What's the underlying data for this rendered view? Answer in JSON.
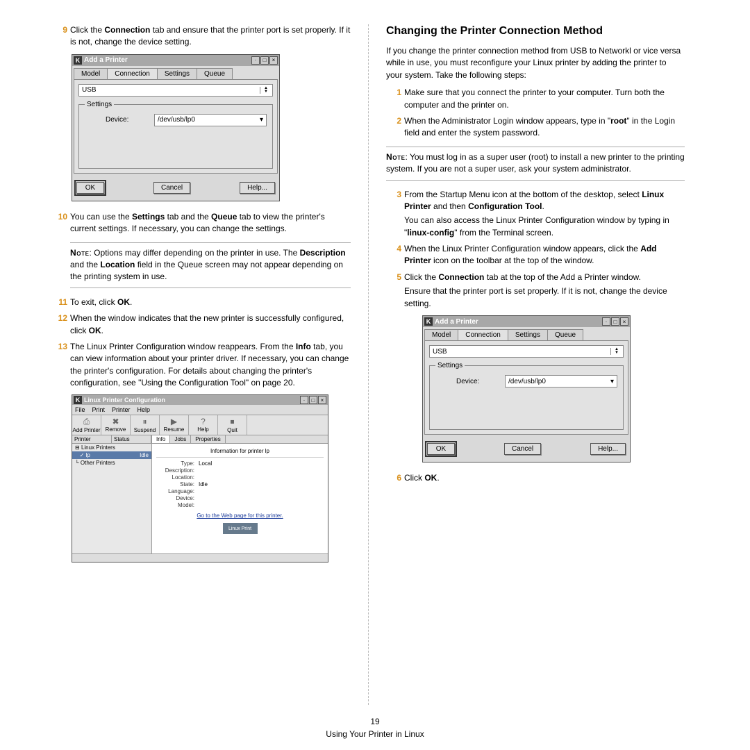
{
  "page": {
    "number": "19",
    "footer": "Using Your Printer in Linux"
  },
  "left": {
    "s9": {
      "num": "9",
      "t1": "Click the ",
      "t2": "Connection",
      "t3": " tab and ensure that the printer port is set properly. If it is not, change the device setting."
    },
    "s10": {
      "num": "10",
      "t1": "You can use the ",
      "t2": "Settings",
      "t3": " tab and the ",
      "t4": "Queue",
      "t5": " tab to view the printer's current settings. If necessary, you can change the settings."
    },
    "note": {
      "lbl": "Note",
      "t1": ": Options may differ depending on the printer in use. The ",
      "t2": "Description",
      "t3": " and the ",
      "t4": "Location",
      "t5": " field in the Queue screen may not appear depending on the printing system in use."
    },
    "s11": {
      "num": "11",
      "t1": "To exit, click ",
      "t2": "OK",
      "t3": "."
    },
    "s12": {
      "num": "12",
      "t1": "When the window indicates that the new printer is successfully configured, click ",
      "t2": "OK",
      "t3": "."
    },
    "s13": {
      "num": "13",
      "t1": "The Linux Printer Configuration window reappears. From the ",
      "t2": "Info",
      "t3": " tab, you can view information about your printer driver. If necessary, you can change the printer's configuration. For details about changing the printer's configuration, see \"Using the Configuration Tool\" on page 20."
    }
  },
  "right": {
    "heading": "Changing the Printer Connection Method",
    "intro": "If you change the printer connection method from USB to Networkl or vice versa while in use, you must reconfigure your Linux printer by adding the printer to your system. Take the following steps:",
    "s1": {
      "num": "1",
      "t": "Make sure that you connect the printer to your computer. Turn both the computer and the printer on."
    },
    "s2": {
      "num": "2",
      "t1": "When the Administrator Login window appears, type in \"",
      "t2": "root",
      "t3": "\" in the Login field and enter the system password."
    },
    "note": {
      "lbl": "Note",
      "t": ": You must log in as a super user (root) to install a new printer to the printing system. If you are not a super user, ask your system administrator."
    },
    "s3": {
      "num": "3",
      "t1": "From the Startup Menu icon at the bottom of the desktop, select ",
      "t2": "Linux Printer",
      "t3": " and then ",
      "t4": "Configuration Tool",
      "t5": ".",
      "p2a": "You can also access the Linux Printer Configuration window by typing in \"",
      "p2b": "linux-config",
      "p2c": "\" from the Terminal screen."
    },
    "s4": {
      "num": "4",
      "t1": "When the Linux Printer Configuration window appears, click the ",
      "t2": "Add Printer",
      "t3": " icon on the toolbar at the top of the window."
    },
    "s5": {
      "num": "5",
      "t1": "Click the ",
      "t2": "Connection",
      "t3": " tab at the top of the Add a Printer window.",
      "p2": "Ensure that the printer port is set properly. If it is not, change the device setting."
    },
    "s6": {
      "num": "6",
      "t1": "Click ",
      "t2": "OK",
      "t3": "."
    }
  },
  "dlg": {
    "title": "Add a Printer",
    "tabs": [
      "Model",
      "Connection",
      "Settings",
      "Queue"
    ],
    "combo": "USB",
    "legend": "Settings",
    "deviceLabel": "Device:",
    "deviceVal": "/dev/usb/lp0",
    "ok": "OK",
    "cancel": "Cancel",
    "help": "Help..."
  },
  "cfg": {
    "title": "Linux Printer Configuration",
    "menus": [
      "File",
      "Print",
      "Printer",
      "Help"
    ],
    "toolbar": [
      "Add Printer",
      "Remove",
      "Suspend",
      "Resume",
      "Help",
      "Quit"
    ],
    "lh": [
      "Printer",
      "Status"
    ],
    "tree": [
      "Linux Printers",
      "lp",
      "Other Printers"
    ],
    "rtabs": [
      "Info",
      "Jobs",
      "Properties"
    ],
    "infohdr": "Information for printer lp",
    "info": [
      [
        "Type:",
        "Local"
      ],
      [
        "Description:",
        ""
      ],
      [
        "Location:",
        ""
      ],
      [
        "State:",
        "Idle"
      ],
      [
        "Language:",
        ""
      ],
      [
        "Device:",
        ""
      ],
      [
        "Model:",
        ""
      ]
    ],
    "glink": "Go to the Web page for this printer.",
    "logo": "Linux Print"
  }
}
